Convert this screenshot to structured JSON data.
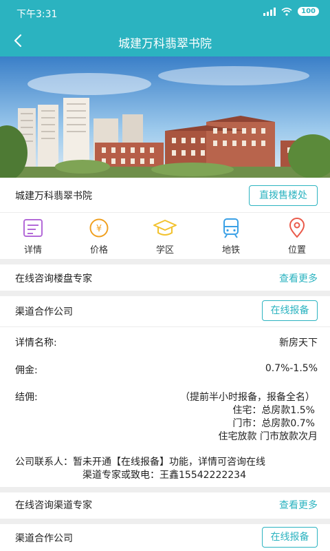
{
  "status_bar": {
    "time": "下午3:31",
    "battery": "100"
  },
  "nav": {
    "title": "城建万科翡翠书院"
  },
  "project": {
    "name": "城建万科翡翠书院",
    "call_button": "直拨售楼处"
  },
  "quick_actions": [
    {
      "label": "详情",
      "icon": "document-icon",
      "color": "#b36ad8"
    },
    {
      "label": "价格",
      "icon": "yen-coin-icon",
      "color": "#f0a020"
    },
    {
      "label": "学区",
      "icon": "graduation-cap-icon",
      "color": "#f2c22e"
    },
    {
      "label": "地铁",
      "icon": "subway-icon",
      "color": "#3aa0e6"
    },
    {
      "label": "位置",
      "icon": "location-pin-icon",
      "color": "#ea5a4a"
    }
  ],
  "consult_sales": {
    "label": "在线咨询楼盘专家",
    "more": "查看更多"
  },
  "partner_1": {
    "label": "渠道合作公司",
    "report_button": "在线报备"
  },
  "details": {
    "name_label": "详情名称:",
    "name_value": "新房天下",
    "commission_label": "佣金:",
    "commission_value": "0.7%-1.5%",
    "settle_label": "结佣:",
    "settle_lines": [
      "（提前半小时报备，报备全名）",
      "住宅：总房款1.5%",
      "门市：总房款0.7%",
      "住宅放款  门市放款次月"
    ],
    "contact_line1": "公司联系人：暂未开通【在线报备】功能，详情可咨询在线",
    "contact_line2": "渠道专家或致电：王鑫15542222234"
  },
  "consult_channel": {
    "label": "在线咨询渠道专家",
    "more": "查看更多"
  },
  "partner_2": {
    "label": "渠道合作公司",
    "report_button": "在线报备"
  },
  "colors": {
    "accent": "#2bb3c0",
    "separator": "#eeeeee"
  }
}
